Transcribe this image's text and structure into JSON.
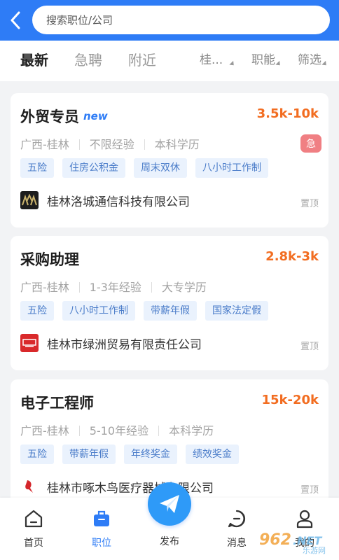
{
  "header": {
    "search_placeholder": "搜索职位/公司"
  },
  "filters": {
    "tabs": [
      "最新",
      "急聘",
      "附近"
    ],
    "dropdowns": [
      "桂...",
      "职能",
      "筛选"
    ]
  },
  "jobs": [
    {
      "title": "外贸专员",
      "badge": "new",
      "salary": "3.5k-10k",
      "location": "广西-桂林",
      "experience": "不限经验",
      "education": "本科学历",
      "urgent": "急",
      "tags": [
        "五险",
        "住房公积金",
        "周末双休",
        "八小时工作制"
      ],
      "company": "桂林洛城通信科技有限公司",
      "pin": "置顶"
    },
    {
      "title": "采购助理",
      "salary": "2.8k-3k",
      "location": "广西-桂林",
      "experience": "1-3年经验",
      "education": "大专学历",
      "tags": [
        "五险",
        "八小时工作制",
        "带薪年假",
        "国家法定假"
      ],
      "company": "桂林市绿洲贸易有限责任公司",
      "pin": "置顶"
    },
    {
      "title": "电子工程师",
      "salary": "15k-20k",
      "location": "广西-桂林",
      "experience": "5-10年经验",
      "education": "本科学历",
      "tags": [
        "五险",
        "带薪年假",
        "年终奖金",
        "绩效奖金"
      ],
      "company": "桂林市啄木鸟医疗器械有限公司",
      "pin": "置顶"
    }
  ],
  "tabbar": {
    "home": "首页",
    "jobs": "职位",
    "publish": "发布",
    "messages": "消息",
    "profile": "我的"
  },
  "watermark": "962.NET 乐游网",
  "colors": {
    "primary": "#2e7cf6",
    "salary": "#f26d21",
    "urgent": "#f07f83",
    "tag_bg": "#eaf2fd",
    "tag_text": "#4a7cc9"
  }
}
